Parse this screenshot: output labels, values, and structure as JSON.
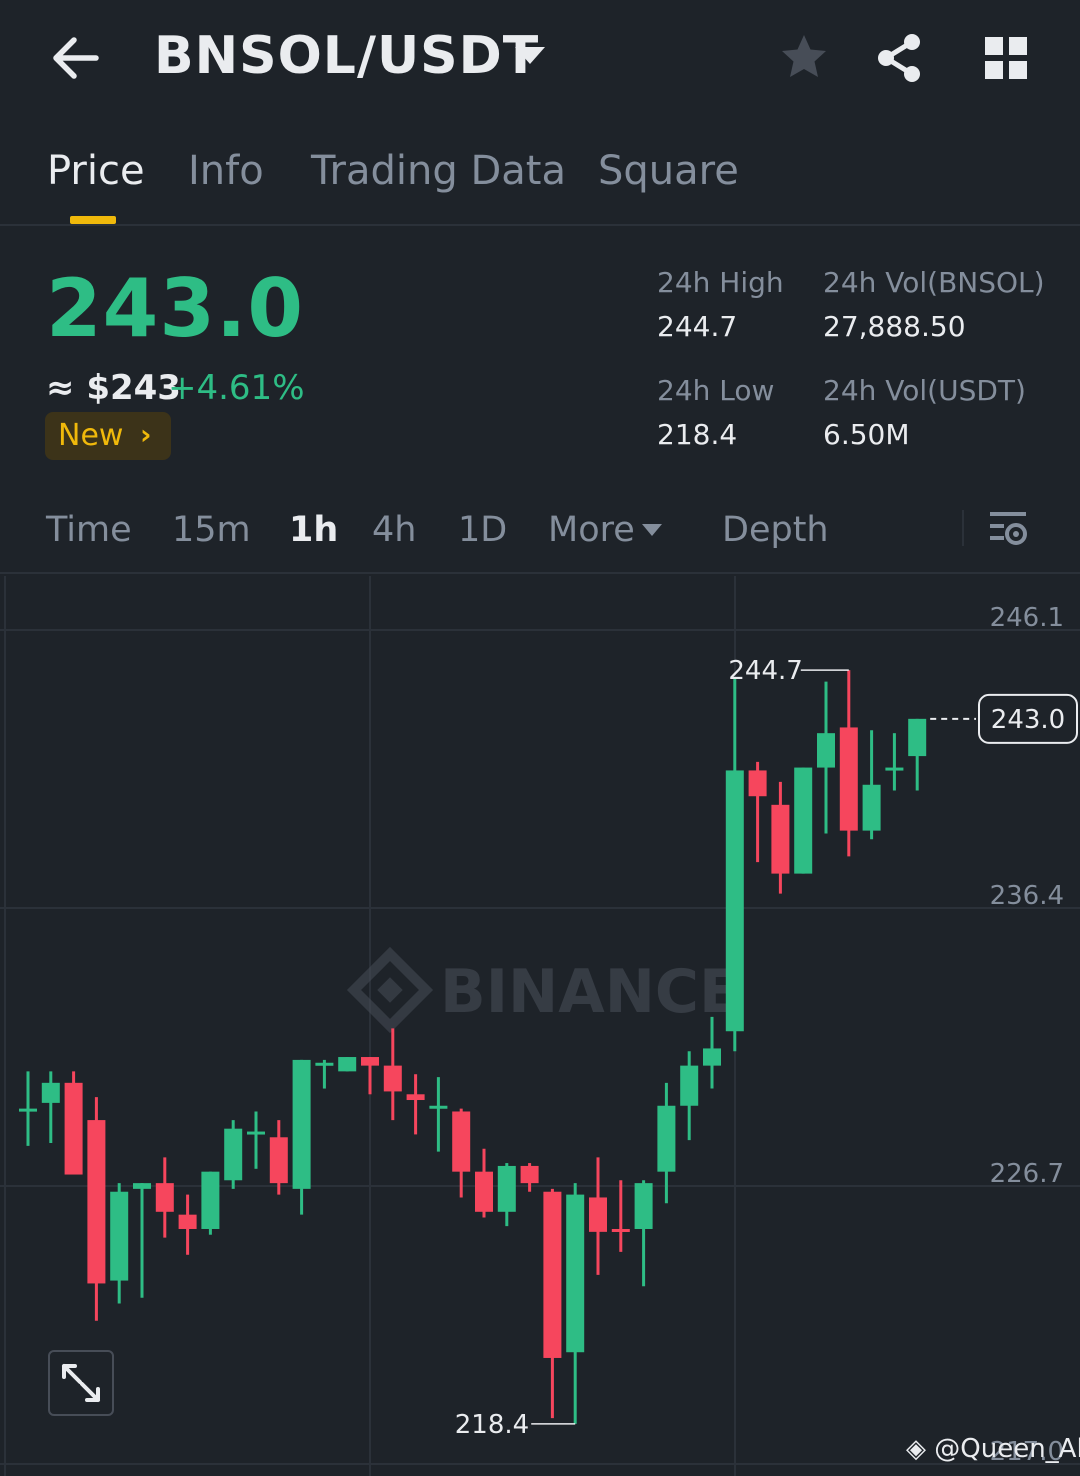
{
  "header": {
    "title": "BNSOL/USDT",
    "icons": [
      "back-arrow-icon",
      "caret-down-icon",
      "star-icon",
      "share-icon",
      "grid-icon"
    ]
  },
  "tabs": [
    {
      "label": "Price",
      "active": true
    },
    {
      "label": "Info",
      "active": false
    },
    {
      "label": "Trading Data",
      "active": false
    },
    {
      "label": "Square",
      "active": false
    }
  ],
  "ticker": {
    "last_price": "243.0",
    "usd_price": "≈ $243",
    "change_pct": "+4.61%",
    "badge": "New",
    "badge_chevron": "›"
  },
  "stats": {
    "high_label": "24h High",
    "high_value": "244.7",
    "low_label": "24h Low",
    "low_value": "218.4",
    "vol_base_label": "24h Vol(BNSOL)",
    "vol_base_value": "27,888.50",
    "vol_quote_label": "24h Vol(USDT)",
    "vol_quote_value": "6.50M"
  },
  "intervals": [
    {
      "label": "Time",
      "active": false
    },
    {
      "label": "15m",
      "active": false
    },
    {
      "label": "1h",
      "active": true
    },
    {
      "label": "4h",
      "active": false
    },
    {
      "label": "1D",
      "active": false
    },
    {
      "label": "More",
      "active": false
    },
    {
      "label": "Depth",
      "active": false
    }
  ],
  "colors": {
    "background": "#1e2329",
    "up": "#2ebd85",
    "down": "#f6465d",
    "accent": "#f0b90b",
    "muted": "#848e9c",
    "grid": "#2b3139"
  },
  "chart": {
    "watermark": "BINANCE",
    "y_ticks": [
      "246.1",
      "236.4",
      "226.7",
      "217.0"
    ],
    "current_price_tag": "243.0",
    "high_marker": "244.7",
    "low_marker": "218.4",
    "credit": "@Queen_Aliza"
  },
  "chart_data": {
    "type": "candlestick",
    "interval": "1h",
    "y_ticks": [
      246.1,
      236.4,
      226.7,
      217.0
    ],
    "ylim": [
      215.6,
      248.0
    ],
    "last_price": 243.0,
    "high": 244.7,
    "low": 218.4,
    "candles": [
      {
        "o": 229.4,
        "h": 230.7,
        "l": 228.1,
        "c": 229.4
      },
      {
        "o": 229.6,
        "h": 230.7,
        "l": 228.2,
        "c": 230.3
      },
      {
        "o": 230.3,
        "h": 230.7,
        "l": 227.6,
        "c": 227.1
      },
      {
        "o": 229.0,
        "h": 229.8,
        "l": 222.0,
        "c": 223.3
      },
      {
        "o": 223.4,
        "h": 226.8,
        "l": 222.6,
        "c": 226.5
      },
      {
        "o": 226.6,
        "h": 226.8,
        "l": 222.8,
        "c": 226.8
      },
      {
        "o": 226.8,
        "h": 227.7,
        "l": 224.9,
        "c": 225.8
      },
      {
        "o": 225.7,
        "h": 226.4,
        "l": 224.3,
        "c": 225.2
      },
      {
        "o": 225.2,
        "h": 227.2,
        "l": 225.0,
        "c": 227.2
      },
      {
        "o": 226.9,
        "h": 229.0,
        "l": 226.6,
        "c": 228.7
      },
      {
        "o": 228.6,
        "h": 229.3,
        "l": 227.3,
        "c": 228.6
      },
      {
        "o": 228.4,
        "h": 229.0,
        "l": 226.4,
        "c": 226.8
      },
      {
        "o": 226.6,
        "h": 231.1,
        "l": 225.7,
        "c": 231.1
      },
      {
        "o": 231.0,
        "h": 231.1,
        "l": 230.1,
        "c": 231.0
      },
      {
        "o": 230.7,
        "h": 231.2,
        "l": 230.7,
        "c": 231.2
      },
      {
        "o": 231.2,
        "h": 231.0,
        "l": 229.9,
        "c": 230.9
      },
      {
        "o": 230.9,
        "h": 232.2,
        "l": 229.0,
        "c": 230.0
      },
      {
        "o": 229.9,
        "h": 230.6,
        "l": 228.5,
        "c": 229.7
      },
      {
        "o": 229.5,
        "h": 230.5,
        "l": 227.9,
        "c": 229.5
      },
      {
        "o": 229.3,
        "h": 229.4,
        "l": 226.3,
        "c": 227.2
      },
      {
        "o": 227.2,
        "h": 228.0,
        "l": 225.6,
        "c": 225.8
      },
      {
        "o": 225.8,
        "h": 227.5,
        "l": 225.3,
        "c": 227.4
      },
      {
        "o": 227.4,
        "h": 227.5,
        "l": 226.5,
        "c": 226.8
      },
      {
        "o": 226.5,
        "h": 226.6,
        "l": 218.6,
        "c": 220.7
      },
      {
        "o": 220.9,
        "h": 226.8,
        "l": 218.4,
        "c": 226.4
      },
      {
        "o": 226.3,
        "h": 227.7,
        "l": 223.6,
        "c": 225.1
      },
      {
        "o": 225.2,
        "h": 226.9,
        "l": 224.4,
        "c": 225.1
      },
      {
        "o": 225.2,
        "h": 226.9,
        "l": 223.2,
        "c": 226.8
      },
      {
        "o": 227.2,
        "h": 230.3,
        "l": 226.1,
        "c": 229.5
      },
      {
        "o": 229.5,
        "h": 231.4,
        "l": 228.3,
        "c": 230.9
      },
      {
        "o": 230.9,
        "h": 232.6,
        "l": 230.1,
        "c": 231.5
      },
      {
        "o": 232.1,
        "h": 244.4,
        "l": 231.4,
        "c": 241.2
      },
      {
        "o": 241.2,
        "h": 241.5,
        "l": 238.0,
        "c": 240.3
      },
      {
        "o": 240.0,
        "h": 240.8,
        "l": 236.9,
        "c": 237.6
      },
      {
        "o": 237.6,
        "h": 240.4,
        "l": 237.6,
        "c": 241.3
      },
      {
        "o": 241.3,
        "h": 244.3,
        "l": 239.0,
        "c": 242.5
      },
      {
        "o": 242.7,
        "h": 244.7,
        "l": 238.2,
        "c": 239.1
      },
      {
        "o": 239.1,
        "h": 242.6,
        "l": 238.8,
        "c": 240.7
      },
      {
        "o": 241.3,
        "h": 242.5,
        "l": 240.5,
        "c": 241.3
      },
      {
        "o": 241.7,
        "h": 243.0,
        "l": 240.5,
        "c": 243.0
      }
    ]
  }
}
